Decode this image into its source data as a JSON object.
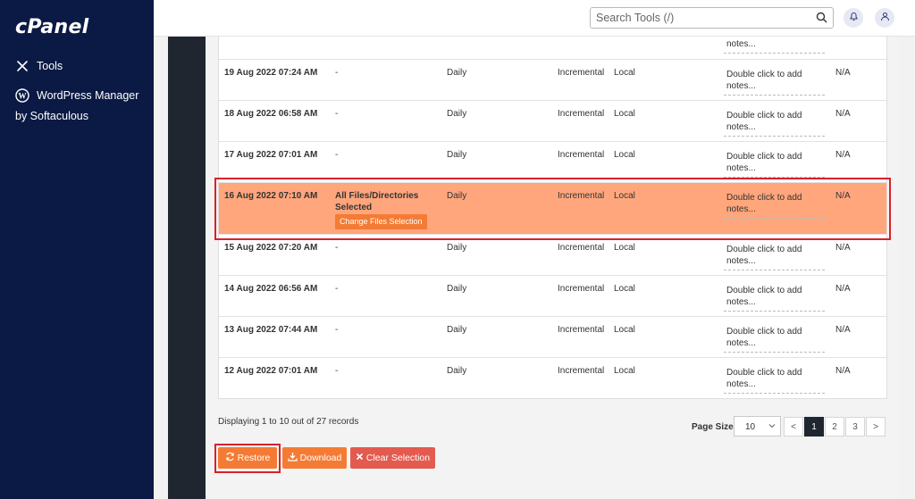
{
  "app": {
    "logo": "cPanel"
  },
  "sidebar": {
    "items": [
      {
        "label": "Tools",
        "icon": "tools-icon"
      },
      {
        "label": "WordPress Manager by Softaculous",
        "icon": "wordpress-icon"
      }
    ]
  },
  "header": {
    "search_placeholder": "Search Tools (/)"
  },
  "table": {
    "top_partial_notes": "notes...",
    "rows": [
      {
        "date": "19 Aug 2022 07:24 AM",
        "files": "-",
        "frequency": "Daily",
        "type": "Incremental",
        "location": "Local",
        "notes": "Double click to add notes...",
        "na": "N/A"
      },
      {
        "date": "18 Aug 2022 06:58 AM",
        "files": "-",
        "frequency": "Daily",
        "type": "Incremental",
        "location": "Local",
        "notes": "Double click to add notes...",
        "na": "N/A"
      },
      {
        "date": "17 Aug 2022 07:01 AM",
        "files": "-",
        "frequency": "Daily",
        "type": "Incremental",
        "location": "Local",
        "notes": "Double click to add notes...",
        "na": "N/A"
      },
      {
        "date": "16 Aug 2022 07:10 AM",
        "files": "All Files/Directories Selected",
        "change_label": "Change Files Selection",
        "frequency": "Daily",
        "type": "Incremental",
        "location": "Local",
        "notes": "Double click to add notes...",
        "na": "N/A",
        "selected": true
      },
      {
        "date": "15 Aug 2022 07:20 AM",
        "files": "-",
        "frequency": "Daily",
        "type": "Incremental",
        "location": "Local",
        "notes": "Double click to add notes...",
        "na": "N/A"
      },
      {
        "date": "14 Aug 2022 06:56 AM",
        "files": "-",
        "frequency": "Daily",
        "type": "Incremental",
        "location": "Local",
        "notes": "Double click to add notes...",
        "na": "N/A"
      },
      {
        "date": "13 Aug 2022 07:44 AM",
        "files": "-",
        "frequency": "Daily",
        "type": "Incremental",
        "location": "Local",
        "notes": "Double click to add notes...",
        "na": "N/A"
      },
      {
        "date": "12 Aug 2022 07:01 AM",
        "files": "-",
        "frequency": "Daily",
        "type": "Incremental",
        "location": "Local",
        "notes": "Double click to add notes...",
        "na": "N/A"
      }
    ]
  },
  "footer": {
    "records_text": "Displaying 1 to 10 out of 27 records",
    "page_size_label": "Page Size",
    "page_size_value": "10",
    "pages": [
      "<",
      "1",
      "2",
      "3",
      ">"
    ],
    "current_page": "1",
    "restore_label": "Restore",
    "download_label": "Download",
    "clear_label": "Clear Selection"
  },
  "colors": {
    "sidebar": "#0b1a44",
    "accent": "#f47b34",
    "selected_row": "#ffa67c",
    "clear": "#e35b4f",
    "highlight": "#d9212b"
  }
}
